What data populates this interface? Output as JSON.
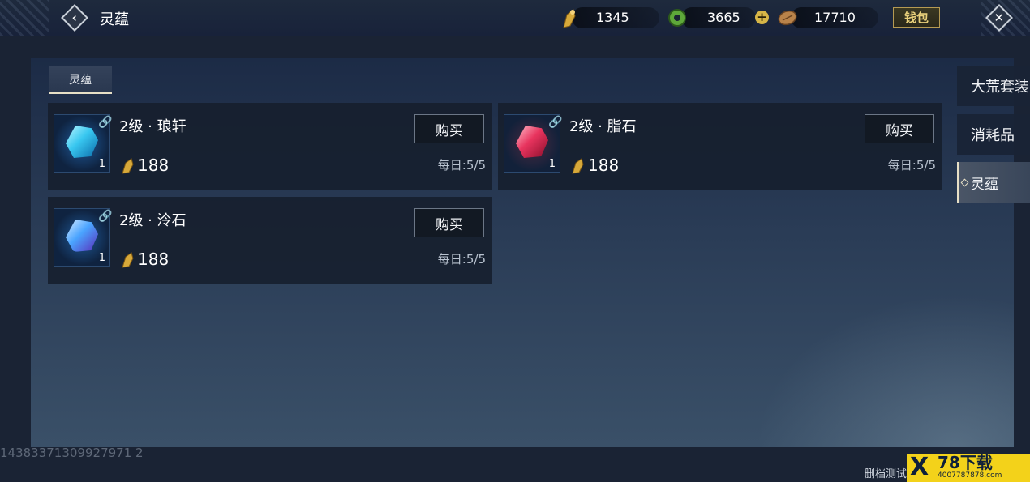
{
  "header": {
    "title": "灵蕴",
    "back_icon": "back-arrow-icon",
    "currencies": [
      {
        "name": "gold-bell",
        "value": "1345",
        "icon": "gold-bell-icon"
      },
      {
        "name": "jade-coin",
        "value": "3665",
        "icon": "jade-coin-icon"
      },
      {
        "name": "copper-token",
        "value": "17710",
        "icon": "copper-token-icon"
      }
    ],
    "wallet_label": "钱包",
    "close_icon": "close-icon"
  },
  "tabs": [
    {
      "label": "灵蕴",
      "active": true
    }
  ],
  "items": [
    {
      "name": "2级 · 琅轩",
      "count": "1",
      "price": "188",
      "buy_label": "购买",
      "daily": "每日:5/5",
      "gem": "cyan-gem"
    },
    {
      "name": "2级 · 脂石",
      "count": "1",
      "price": "188",
      "buy_label": "购买",
      "daily": "每日:5/5",
      "gem": "red-gem"
    },
    {
      "name": "2级 · 泠石",
      "count": "1",
      "price": "188",
      "buy_label": "购买",
      "daily": "每日:5/5",
      "gem": "blue-gem"
    }
  ],
  "sidebar": {
    "items": [
      {
        "label": "大荒套装"
      },
      {
        "label": "消耗品"
      },
      {
        "label": "灵蕴",
        "active": true
      }
    ]
  },
  "footer": {
    "uid": "14383371309927971 2",
    "note": "删档测试"
  },
  "watermark": {
    "mark": "X",
    "text": "78下载",
    "sub": "4007787878.com"
  },
  "colors": {
    "accent_gold": "#e6dfc6",
    "wallet_gold": "#e7cf7a",
    "panel_bg": "#1c2b46"
  }
}
